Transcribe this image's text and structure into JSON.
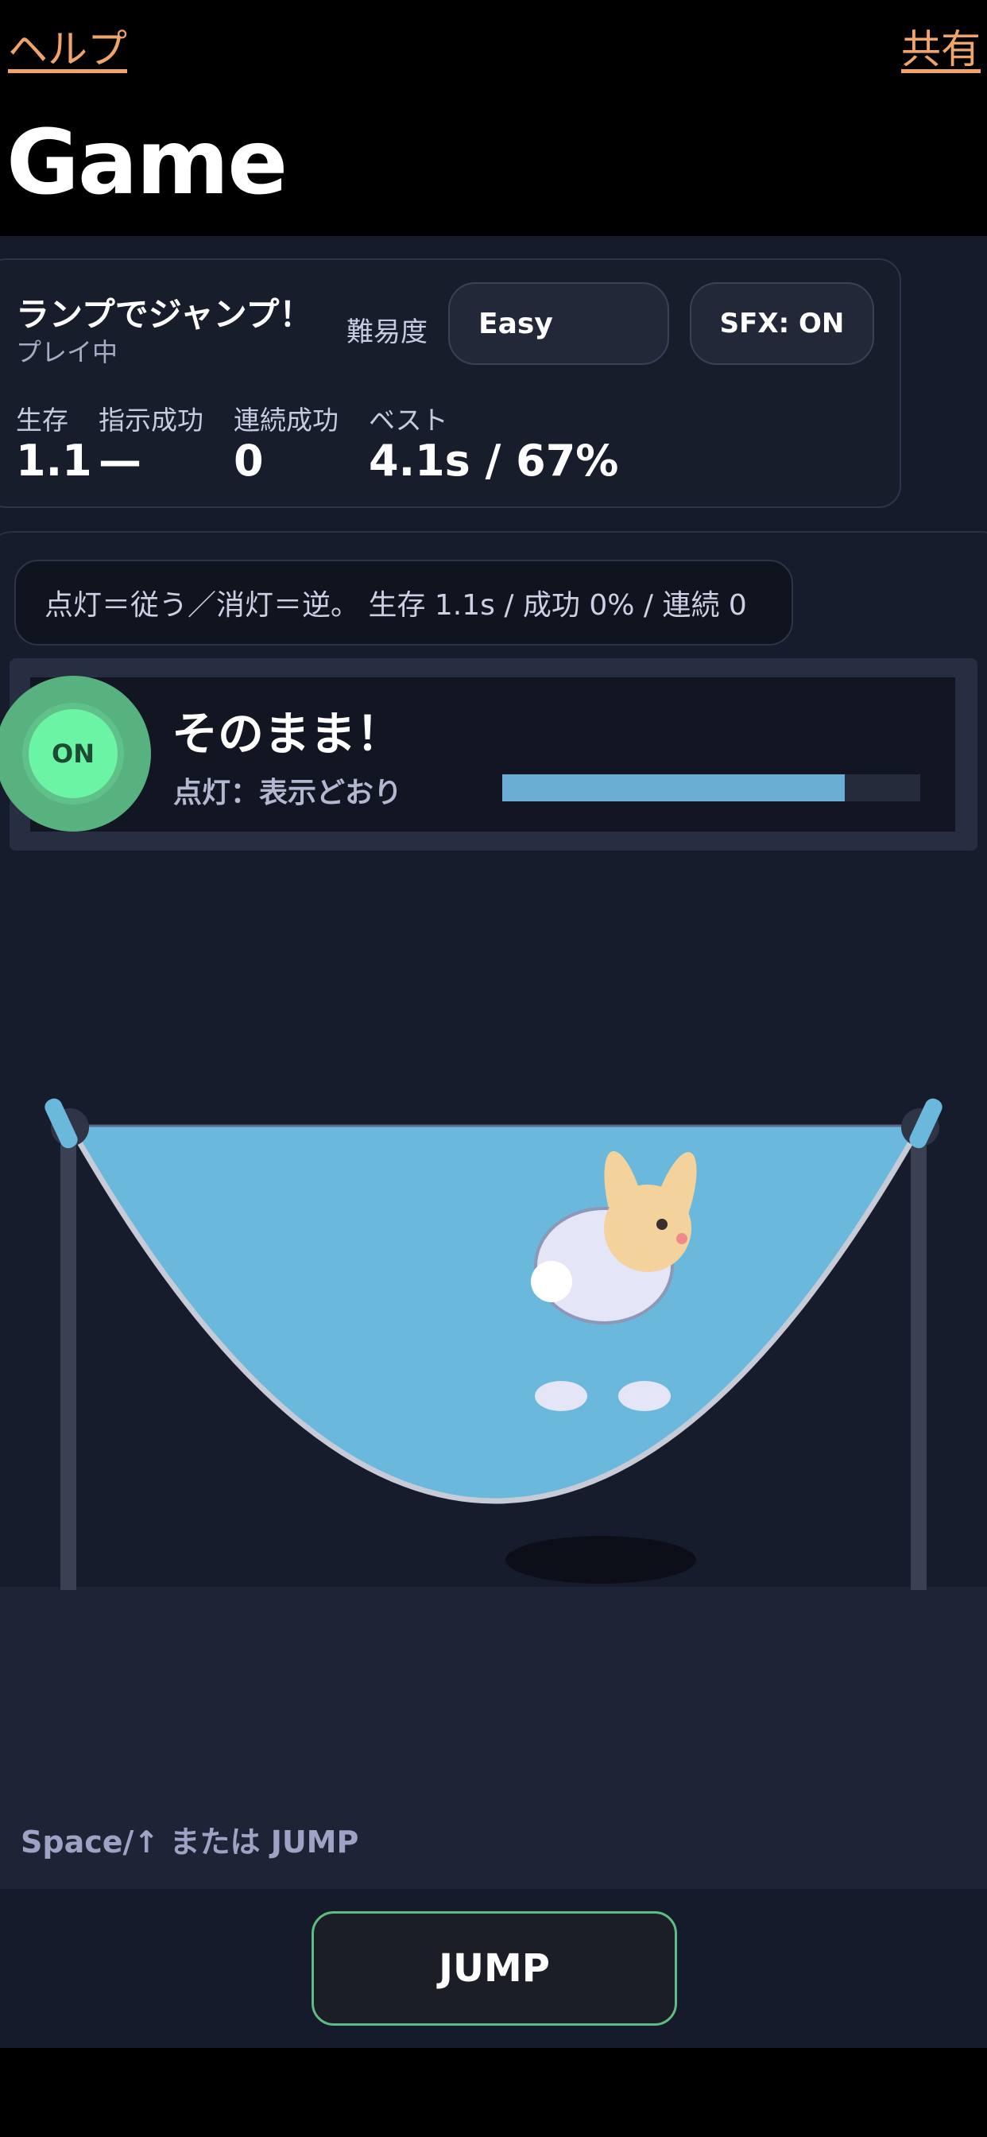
{
  "topbar": {
    "help": "ヘルプ",
    "share": "共有"
  },
  "page_title": "Game",
  "game": {
    "title": "ランプでジャンプ！",
    "status": "プレイ中",
    "difficulty_label": "難易度",
    "difficulty_value": "Easy",
    "sfx": "SFX: ON"
  },
  "stats": [
    {
      "label": "生存",
      "value": "1.1"
    },
    {
      "label": "指示成功",
      "value": "—"
    },
    {
      "label": "連続成功",
      "value": "0"
    },
    {
      "label": "ベスト",
      "value": "4.1s / 67%"
    }
  ],
  "hint": "点灯＝従う／消灯＝逆。 生存 1.1s / 成功 0% / 連続 0",
  "lamp": {
    "state": "ON",
    "color": "#6cf4a5"
  },
  "instruction": {
    "title": "そのまま！",
    "subtitle": "点灯：表示どおり",
    "timer_fraction": 0.82
  },
  "controls_hint": "Space/↑ または JUMP",
  "jump_button": "JUMP",
  "colors": {
    "accent_link": "#f0a46a",
    "trampoline": "#6ab8dc",
    "bunny": "#f4d29b"
  }
}
